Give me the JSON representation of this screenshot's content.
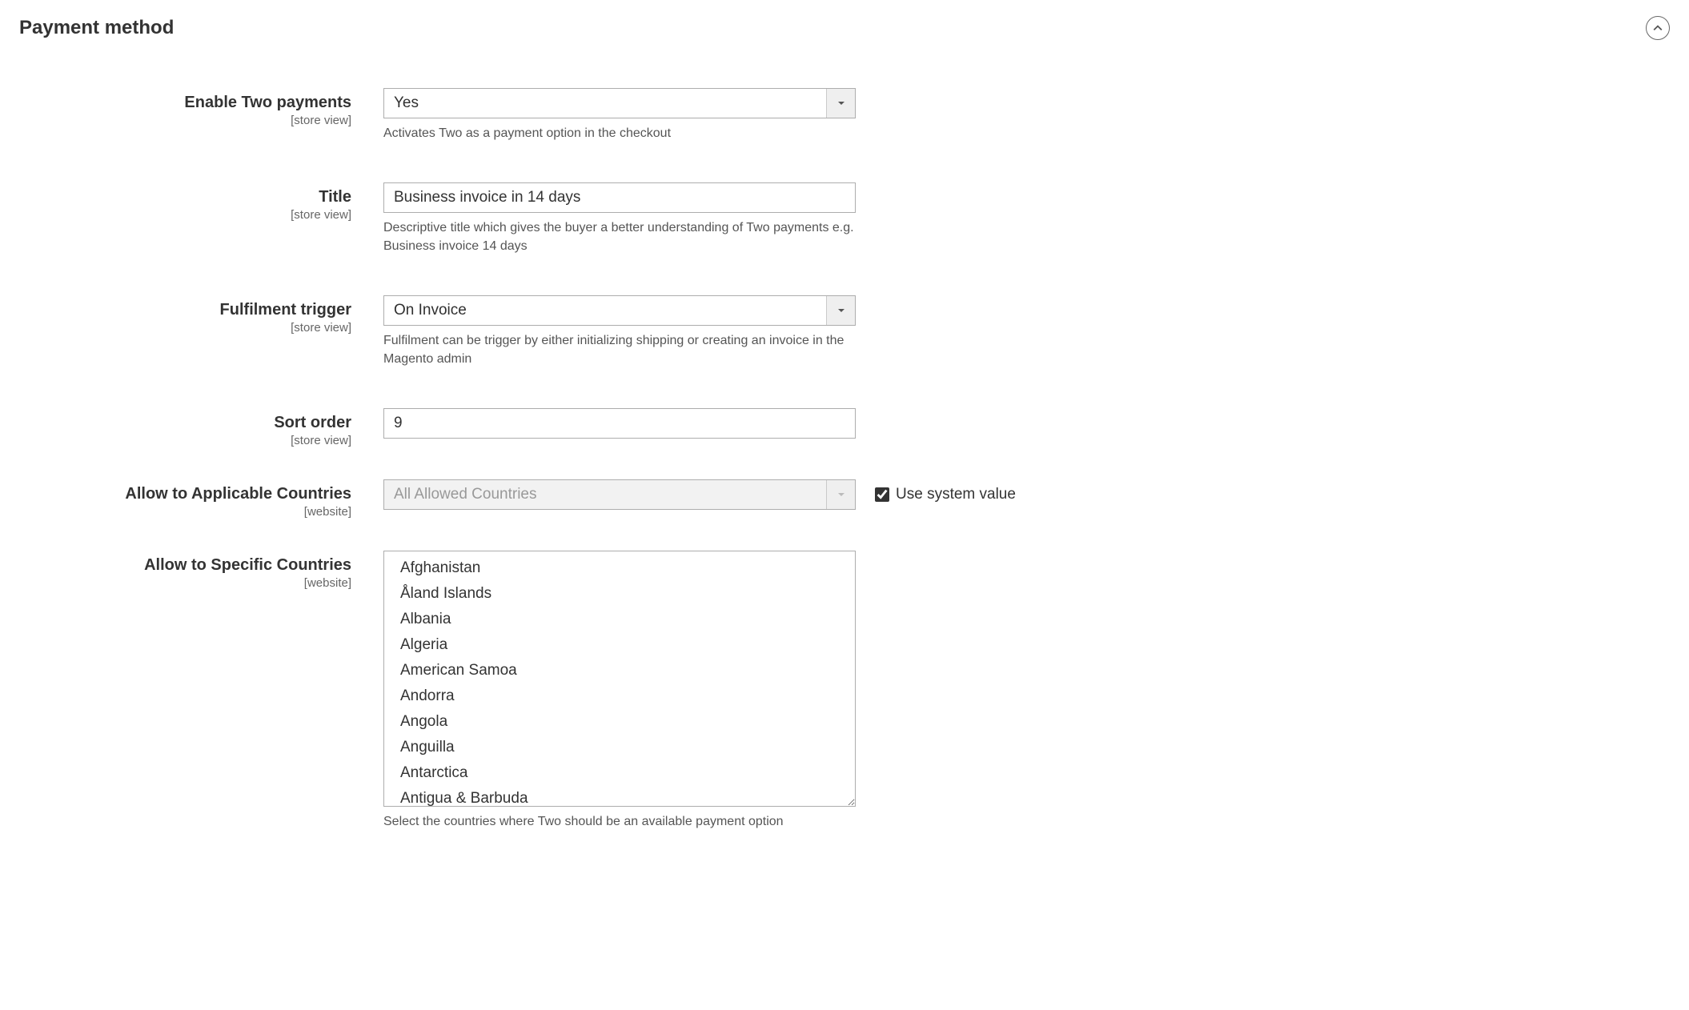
{
  "section": {
    "title": "Payment method"
  },
  "scope": {
    "store_view": "[store view]",
    "website": "[website]"
  },
  "fields": {
    "enable": {
      "label": "Enable Two payments",
      "value": "Yes",
      "help": "Activates Two as a payment option in the checkout"
    },
    "title": {
      "label": "Title",
      "value": "Business invoice in 14 days",
      "help": "Descriptive title which gives the buyer a better understanding of Two payments e.g. Business invoice 14 days"
    },
    "fulfilment": {
      "label": "Fulfilment trigger",
      "value": "On Invoice",
      "help": "Fulfilment can be trigger by either initializing shipping or creating an invoice in the Magento admin"
    },
    "sort_order": {
      "label": "Sort order",
      "value": "9"
    },
    "applicable_countries": {
      "label": "Allow to Applicable Countries",
      "value": "All Allowed Countries",
      "use_system_label": "Use system value"
    },
    "specific_countries": {
      "label": "Allow to Specific Countries",
      "help": "Select the countries where Two should be an available payment option",
      "options": [
        "Afghanistan",
        "Åland Islands",
        "Albania",
        "Algeria",
        "American Samoa",
        "Andorra",
        "Angola",
        "Anguilla",
        "Antarctica",
        "Antigua & Barbuda"
      ]
    }
  }
}
